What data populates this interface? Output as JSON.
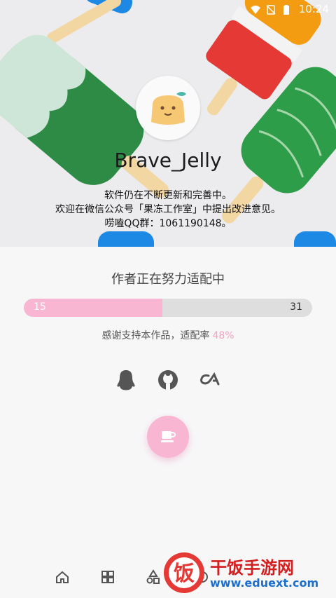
{
  "status_bar": {
    "time": "10:24"
  },
  "profile": {
    "username": "Brave_Jelly",
    "intro_lines": [
      "软件仍在不断更新和完善中。",
      "欢迎在微信公众号「果冻工作室」中提出改进意见。",
      "唠嗑QQ群：1061190148。"
    ]
  },
  "adaptation": {
    "title": "作者正在努力适配中",
    "progress_left": "15",
    "progress_right": "31",
    "progress_fraction": 0.48,
    "thanks_text": "感谢支持本作品，适配率",
    "rate_text": "48%",
    "accent_color": "#f9b6d2"
  },
  "social_icons": [
    "qq-icon",
    "github-icon",
    "coolapk-icon"
  ],
  "fab_icon": "coffee-cup-icon",
  "bottom_nav_icons": [
    "home-icon",
    "apps-icon",
    "shapes-icon",
    "extra-icon"
  ],
  "watermark": {
    "name": "干饭手游网",
    "url": "www.eduext.com",
    "logo_char": "饭"
  }
}
